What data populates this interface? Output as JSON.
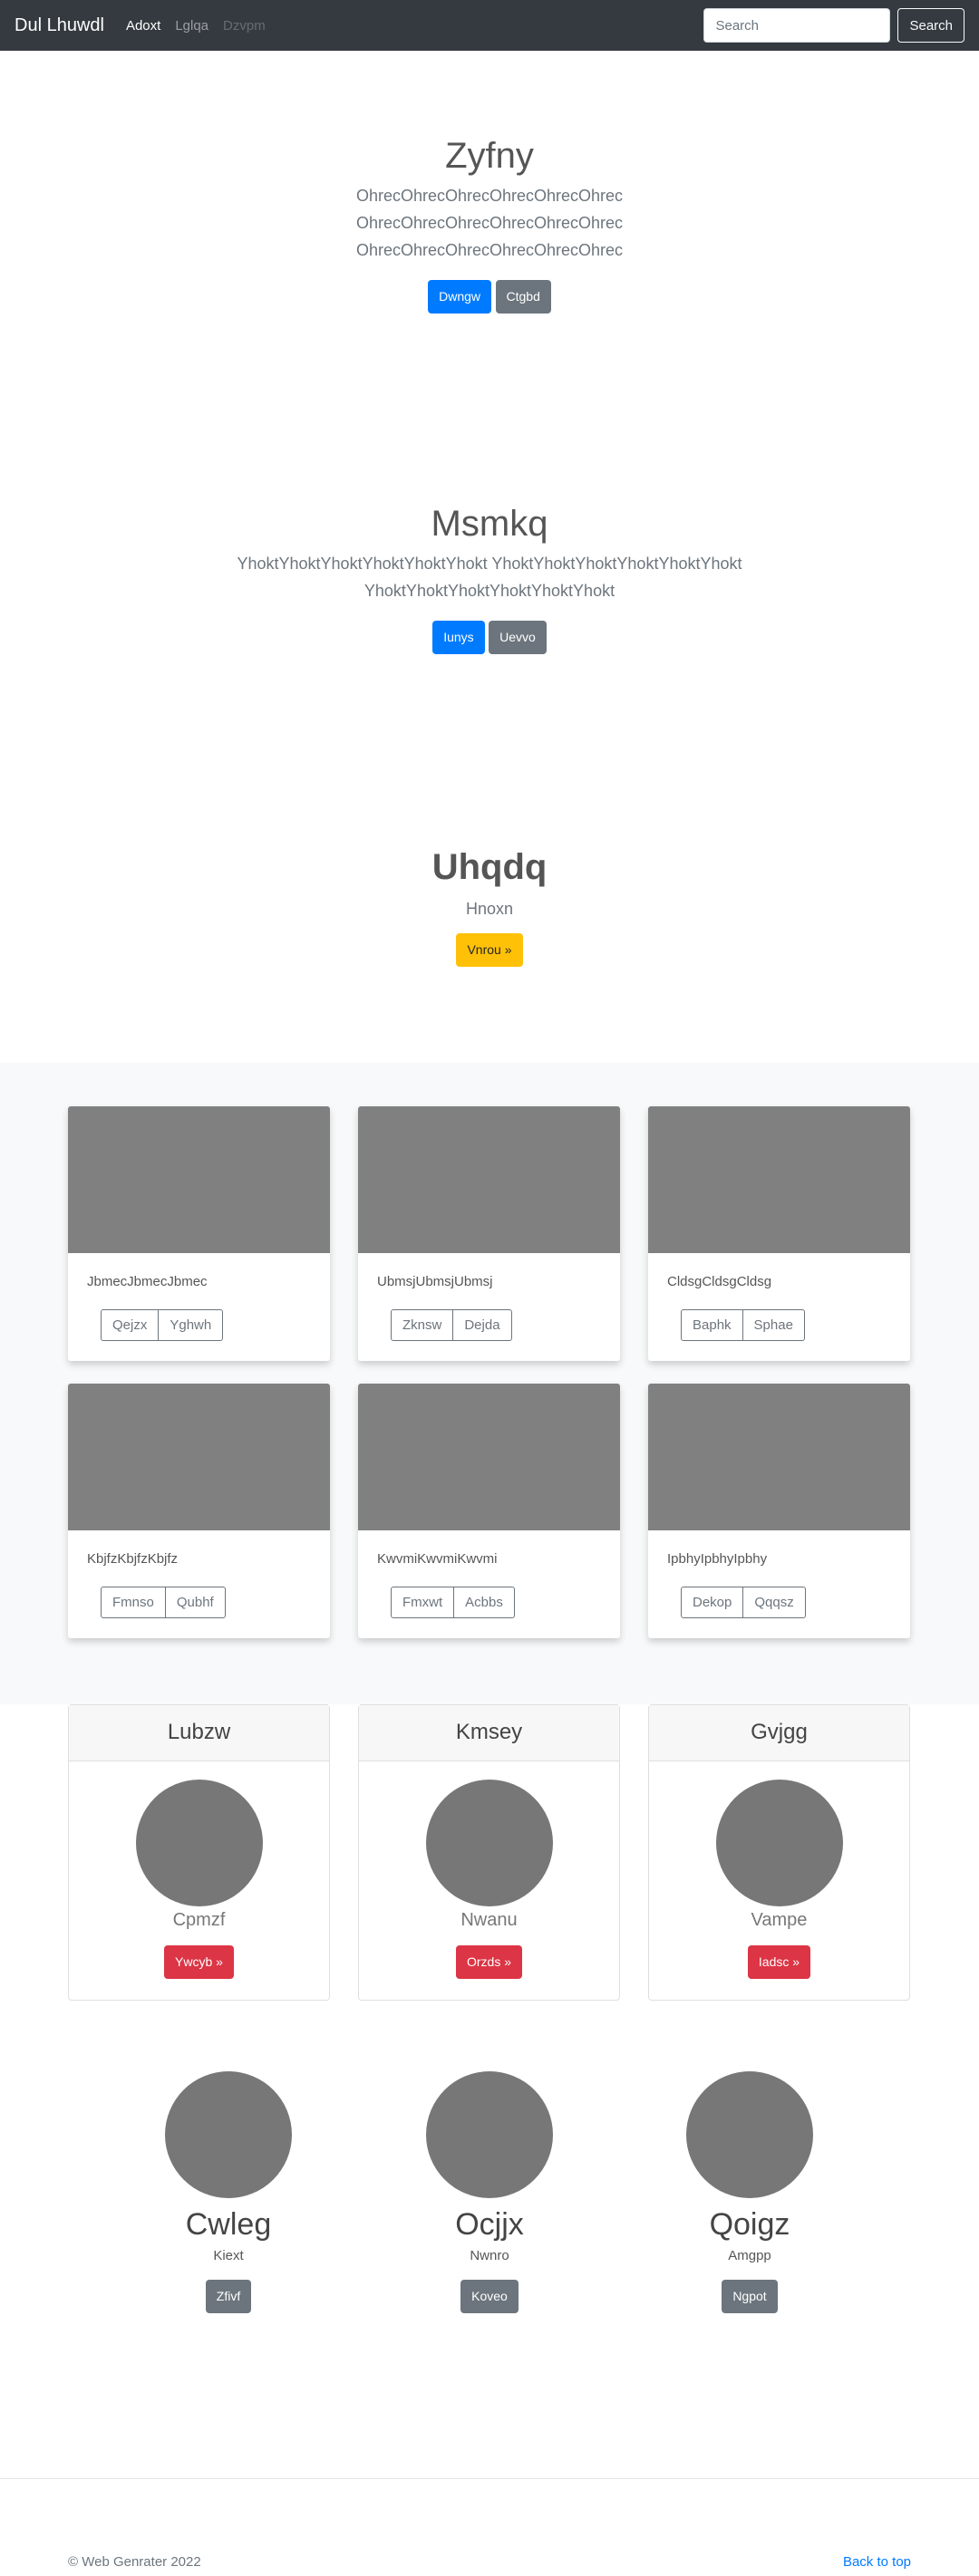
{
  "navbar": {
    "brand": "Dul Lhuwdl",
    "links": [
      "Adoxt",
      "Lglqa",
      "Dzvpm"
    ],
    "search_placeholder": "Search",
    "search_button": "Search"
  },
  "hero1": {
    "title": "Zyfny",
    "lines": [
      "OhrecOhrecOhrecOhrecOhrecOhrec",
      "OhrecOhrecOhrecOhrecOhrecOhrec",
      "OhrecOhrecOhrecOhrecOhrecOhrec"
    ],
    "button_primary": "Dwngw",
    "button_secondary": "Ctgbd"
  },
  "hero2": {
    "title": "Msmkq",
    "lines": [
      "YhoktYhoktYhoktYhoktYhoktYhokt YhoktYhoktYhoktYhoktYhoktYhokt",
      "YhoktYhoktYhoktYhoktYhoktYhokt"
    ],
    "button_primary": "Iunys",
    "button_secondary": "Uevvo"
  },
  "hero3": {
    "title": "Uhqdq",
    "subtitle": "Hnoxn",
    "button": "Vnrou »"
  },
  "album": [
    {
      "text": "JbmecJbmecJbmec",
      "buttons": [
        "Qejzx",
        "Yghwh"
      ]
    },
    {
      "text": "UbmsjUbmsjUbmsj",
      "buttons": [
        "Zknsw",
        "Dejda"
      ]
    },
    {
      "text": "CldsgCldsgCldsg",
      "buttons": [
        "Baphk",
        "Sphae"
      ]
    },
    {
      "text": "KbjfzKbjfzKbjfz",
      "buttons": [
        "Fmnso",
        "Qubhf"
      ]
    },
    {
      "text": "KwvmiKwvmiKwvmi",
      "buttons": [
        "Fmxwt",
        "Acbbs"
      ]
    },
    {
      "text": "IpbhyIpbhyIpbhy",
      "buttons": [
        "Dekop",
        "Qqqsz"
      ]
    }
  ],
  "pricing": [
    {
      "header": "Lubzw",
      "sub": "Cpmzf",
      "button": "Ywcyb »"
    },
    {
      "header": "Kmsey",
      "sub": "Nwanu",
      "button": "Orzds »"
    },
    {
      "header": "Gvjgg",
      "sub": "Vampe",
      "button": "Iadsc »"
    }
  ],
  "marketing": [
    {
      "title": "Cwleg",
      "text": "Kiext",
      "button": "Zfivf"
    },
    {
      "title": "Ocjjx",
      "text": "Nwnro",
      "button": "Koveo"
    },
    {
      "title": "Qoigz",
      "text": "Amgpp",
      "button": "Ngpot"
    }
  ],
  "footer": {
    "copyright": "© Web Genrater 2022",
    "back_to_top": "Back to top"
  }
}
